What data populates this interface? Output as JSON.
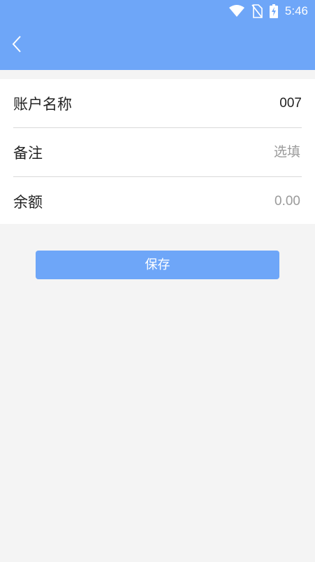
{
  "status_bar": {
    "time": "5:46",
    "icons": [
      "wifi-icon",
      "no-sim-icon",
      "battery-charging-icon"
    ]
  },
  "header": {
    "back_icon": "chevron-left-icon"
  },
  "form": {
    "account_name": {
      "label": "账户名称",
      "value": "007"
    },
    "remark": {
      "label": "备注",
      "placeholder": "选填",
      "value": ""
    },
    "balance": {
      "label": "余额",
      "placeholder": "0.00",
      "value": ""
    }
  },
  "save_button": {
    "label": "保存"
  },
  "colors": {
    "primary": "#6ea6f8",
    "background": "#f4f4f4",
    "placeholder": "#9a9a9a",
    "divider": "#d9d9d9"
  }
}
